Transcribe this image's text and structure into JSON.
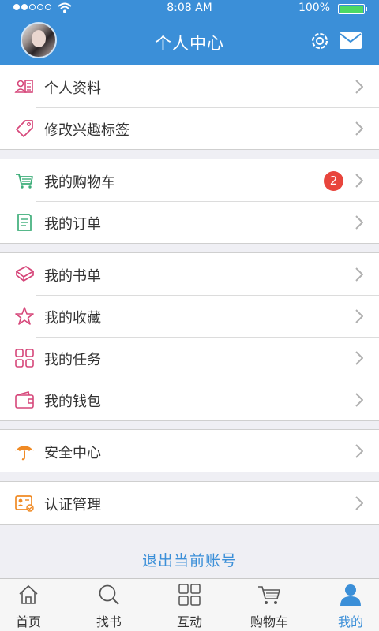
{
  "status_bar": {
    "time": "8:08 AM",
    "battery": "100%"
  },
  "header": {
    "title": "个人中心"
  },
  "menu": {
    "g1": [
      "个人资料",
      "修改兴趣标签"
    ],
    "g2": [
      "我的购物车",
      "我的订单"
    ],
    "g3": [
      "我的书单",
      "我的收藏",
      "我的任务",
      "我的钱包"
    ],
    "g4": [
      "安全中心"
    ],
    "g5": [
      "认证管理"
    ]
  },
  "cart_badge": "2",
  "logout_label": "退出当前账号",
  "tabs": [
    "首页",
    "找书",
    "互动",
    "购物车",
    "我的"
  ],
  "colors": {
    "primary": "#3b8fd8",
    "pink": "#d6477a",
    "green": "#3fae7a",
    "orange": "#f08a24",
    "badge": "#e8453c"
  }
}
